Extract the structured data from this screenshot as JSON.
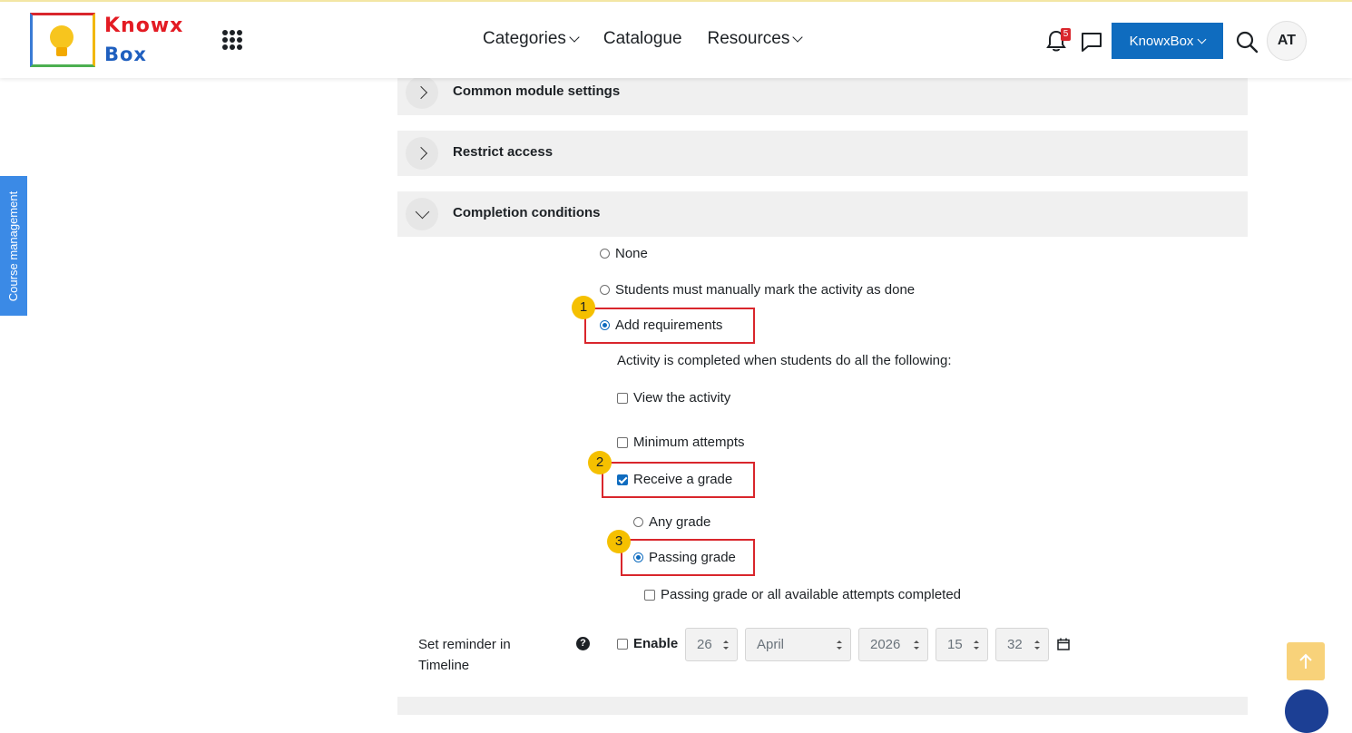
{
  "header": {
    "logo_line1": "Knowx",
    "logo_line2": "Box",
    "nav": [
      {
        "label": "Categories"
      },
      {
        "label": "Catalogue"
      },
      {
        "label": "Resources"
      }
    ],
    "notification_count": "5",
    "user_button": "KnowxBox",
    "avatar_initials": "AT"
  },
  "side_tab": "Course management",
  "sections": [
    {
      "title": "Common module settings"
    },
    {
      "title": "Restrict access"
    },
    {
      "title": "Completion conditions"
    }
  ],
  "completion": {
    "options": [
      {
        "label": "None",
        "selected": false
      },
      {
        "label": "Students must manually mark the activity as done",
        "selected": false
      },
      {
        "label": "Add requirements",
        "selected": true
      }
    ],
    "note": "Activity is completed when students do all the following:",
    "view_activity": "View the activity",
    "minimum_attempts": "Minimum attempts",
    "receive_grade": "Receive a grade",
    "any_grade": "Any grade",
    "passing_grade": "Passing grade",
    "passing_or_attempts": "Passing grade or all available attempts completed"
  },
  "callouts": [
    "1",
    "2",
    "3"
  ],
  "reminder": {
    "label": "Set reminder in Timeline",
    "help": "?",
    "enable": "Enable",
    "day": "26",
    "month": "April",
    "year": "2026",
    "hour": "15",
    "minute": "32"
  },
  "colors": {
    "primary": "#0f6cbf",
    "highlight": "#d9262c",
    "callout": "#f5c000",
    "side_tab": "#3b8ae6"
  }
}
